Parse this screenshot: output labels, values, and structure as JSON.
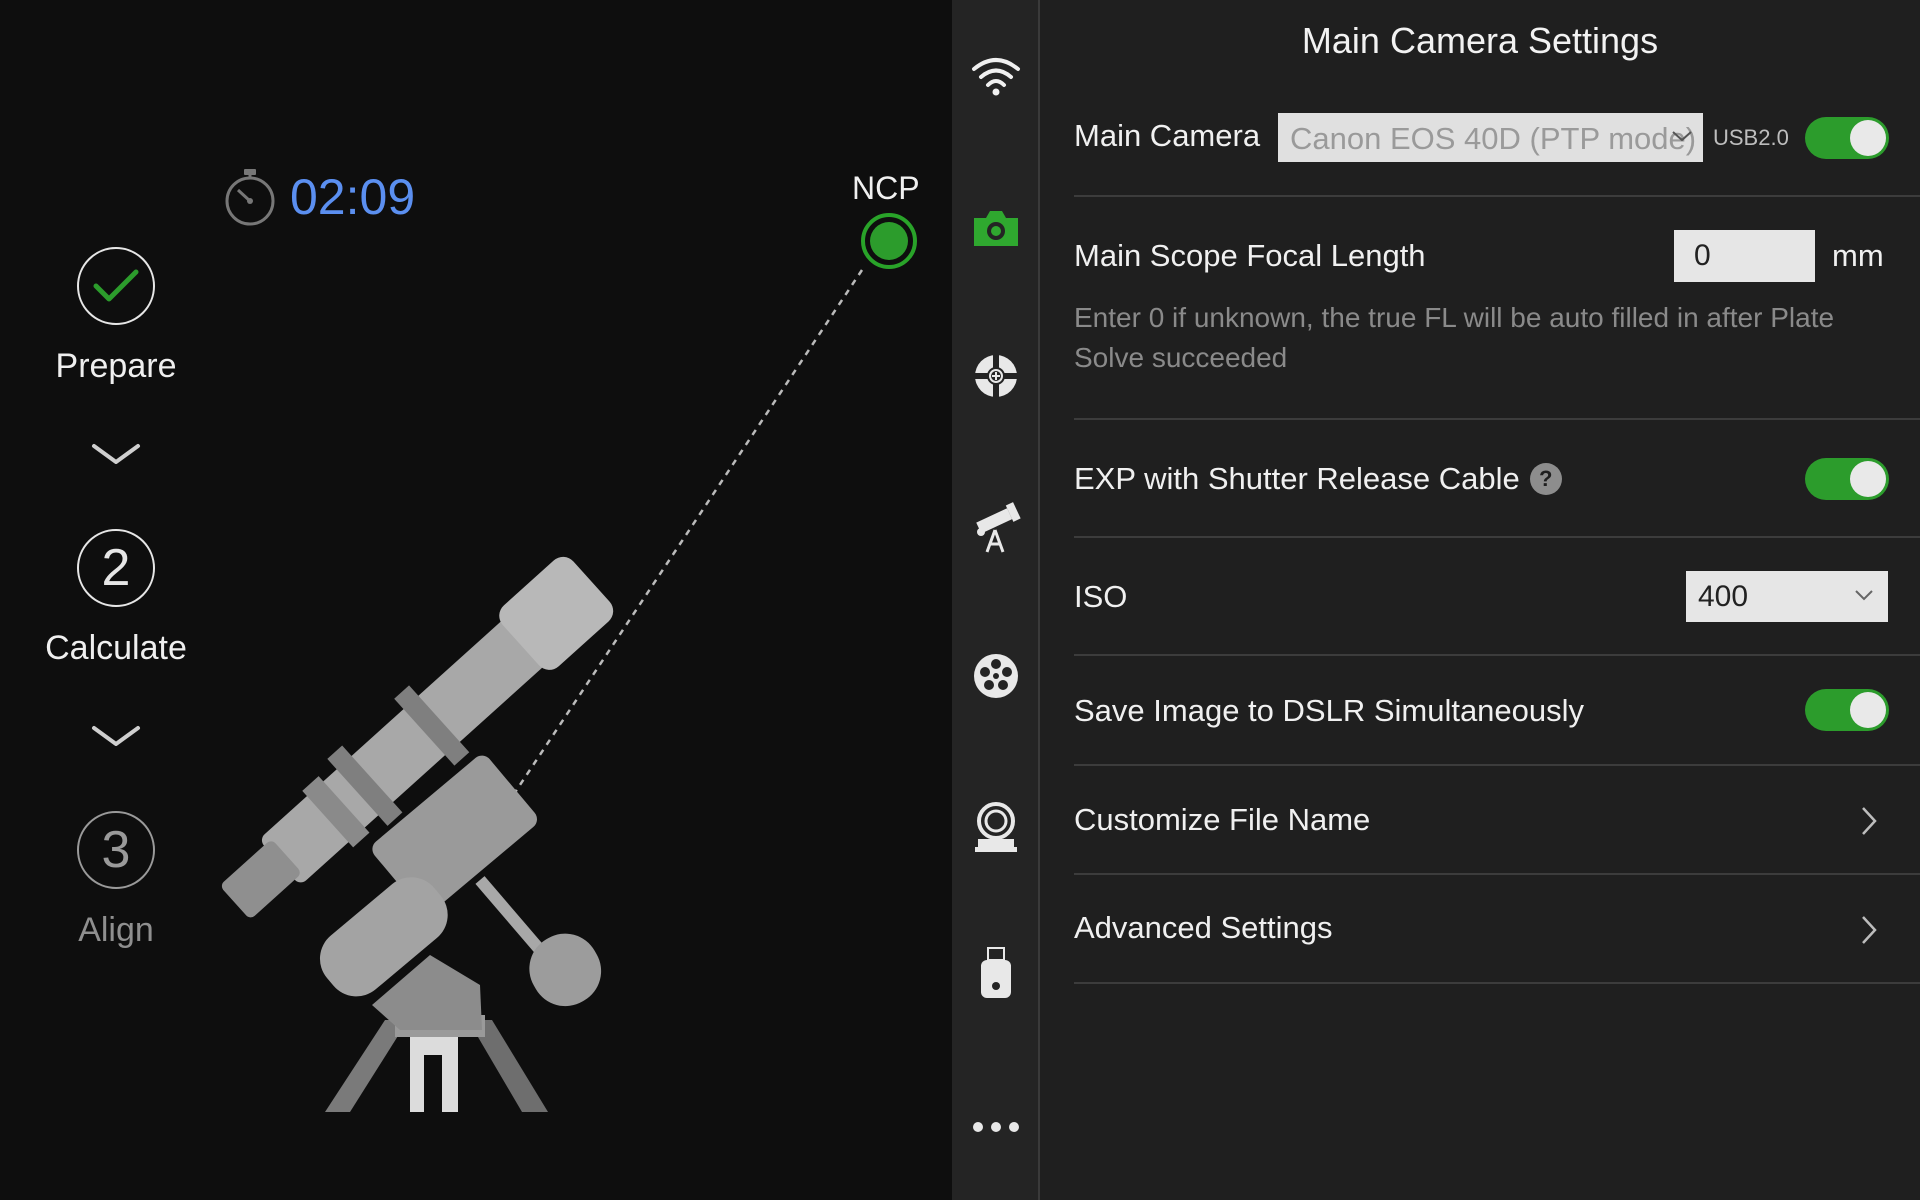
{
  "timer": "02:09",
  "ncp_label": "NCP",
  "steps": [
    {
      "number": "",
      "label": "Prepare",
      "state": "done"
    },
    {
      "number": "2",
      "label": "Calculate",
      "state": "active"
    },
    {
      "number": "3",
      "label": "Align",
      "state": "pending"
    }
  ],
  "rail_icons": [
    "wifi-icon",
    "camera-icon",
    "guide-crosshair-icon",
    "telescope-mount-icon",
    "filter-wheel-icon",
    "focuser-icon",
    "usb-drive-icon",
    "more-icon"
  ],
  "settings": {
    "title": "Main Camera Settings",
    "main_camera_label": "Main Camera",
    "main_camera_value": "Canon EOS 40D (PTP mode)",
    "usb_label": "USB2.0",
    "focal_length_label": "Main Scope Focal Length",
    "focal_length_value": "0",
    "focal_length_unit": "mm",
    "focal_length_hint": "Enter 0 if unknown, the true FL will be auto filled in after Plate Solve succeeded",
    "exp_cable_label": "EXP with Shutter Release Cable",
    "help_glyph": "?",
    "iso_label": "ISO",
    "iso_value": "400",
    "save_dslr_label": "Save Image to DSLR Simultaneously",
    "customize_label": "Customize File Name",
    "advanced_label": "Advanced Settings"
  },
  "colors": {
    "accent_green": "#2c9c2c",
    "timer_blue": "#5b8ff0"
  }
}
